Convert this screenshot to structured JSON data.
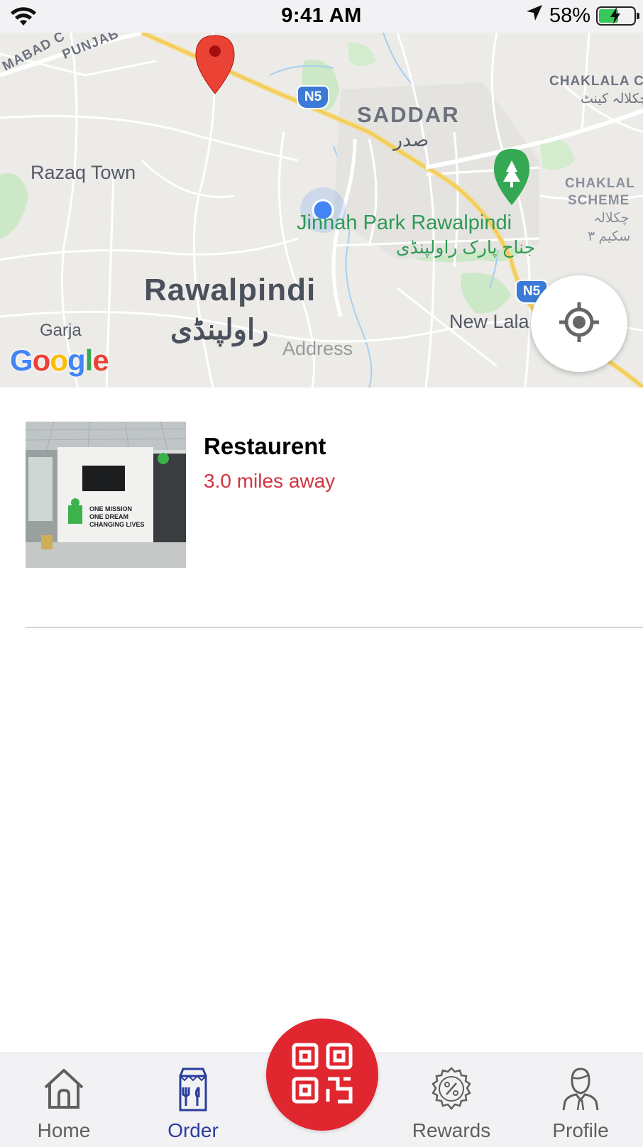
{
  "status_bar": {
    "time": "9:41 AM",
    "battery": "58%",
    "battery_level": 0.58
  },
  "map": {
    "labels": {
      "saddar": "SADDAR",
      "saddar_urdu": "صدر",
      "razaq_town": "Razaq Town",
      "rawalpindi": "Rawalpindi",
      "rawalpindi_urdu": "راولپنڈی",
      "jinnah_park": "Jinnah Park Rawalpindi",
      "jinnah_park_urdu": "جناح پارک راولپنڈی",
      "chaklala_cantt": "CHAKLALA C",
      "chaklala_cantt_urdu": "چکلالہ کینٹ",
      "chaklala_scheme": "CHAKLAL",
      "chaklala_scheme_2": "SCHEME",
      "chaklala_scheme_urdu": "چکلالہ",
      "chaklala_scheme_urdu_2": "سکیم ۳",
      "new_lala": "New Lala",
      "garja": "Garja",
      "punjab": "PUNJAB",
      "islamabad": "MABAD C",
      "address_placeholder": "Address"
    },
    "road_shields": [
      "N5",
      "N5"
    ],
    "logo": [
      "G",
      "o",
      "o",
      "g",
      "l",
      "e"
    ]
  },
  "restaurants": [
    {
      "name": "Restaurent",
      "distance": "3.0 miles away",
      "photo_text": [
        "ONE MISSION",
        "ONE DREAM",
        "CHANGING LIVES"
      ]
    }
  ],
  "tabs": {
    "home": "Home",
    "order": "Order",
    "rewards": "Rewards",
    "profile": "Profile",
    "active": "order"
  },
  "colors": {
    "accent_red": "#e0262f",
    "distance_red": "#d33340",
    "active_tab": "#2a3d9c",
    "park_green": "#2f9a55",
    "user_location_blue": "#4285f4"
  }
}
